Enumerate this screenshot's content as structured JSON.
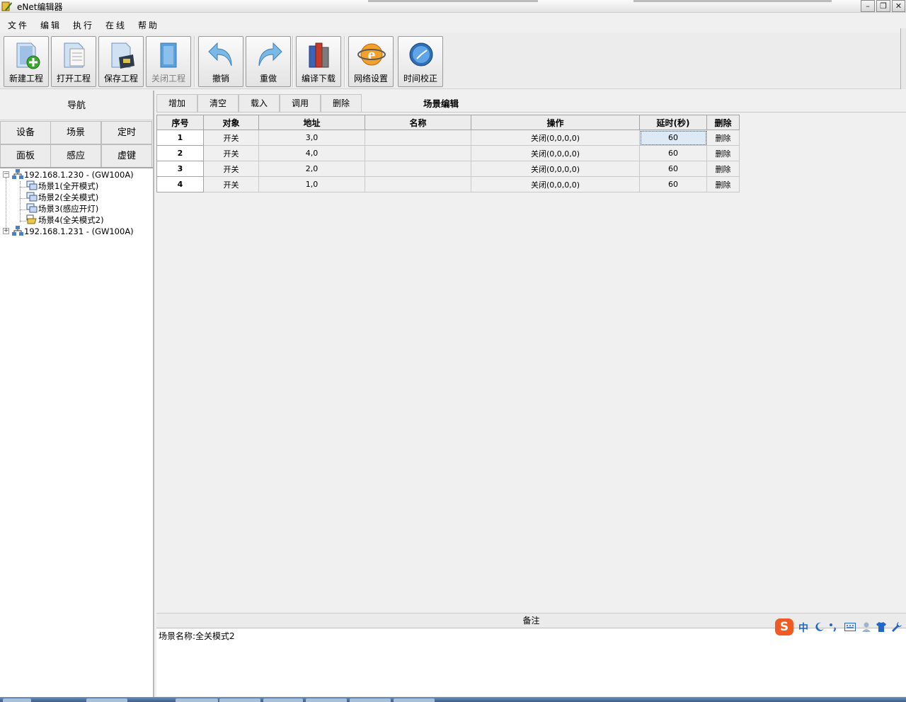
{
  "window": {
    "title": "eNet编辑器"
  },
  "menu": [
    "文件",
    "编辑",
    "执行",
    "在线",
    "帮助"
  ],
  "toolbar": {
    "new_project": "新建工程",
    "open_project": "打开工程",
    "save_project": "保存工程",
    "close_project": "关闭工程",
    "undo": "撤销",
    "redo": "重做",
    "compile_download": "编译下载",
    "network_settings": "网络设置",
    "time_calibrate": "时间校正"
  },
  "nav": {
    "title": "导航",
    "buttons": [
      "设备",
      "场景",
      "定时",
      "面板",
      "感应",
      "虚键"
    ],
    "tree": {
      "gateway1": "192.168.1.230 - (GW100A)",
      "scenes": [
        "场景1(全开模式)",
        "场景2(全关模式)",
        "场景3(感应开灯)",
        "场景4(全关模式2)"
      ],
      "gateway2": "192.168.1.231 - (GW100A)"
    }
  },
  "editor": {
    "title": "场景编辑",
    "tabs": [
      "增加",
      "清空",
      "载入",
      "调用",
      "删除"
    ],
    "columns": [
      "序号",
      "对象",
      "地址",
      "名称",
      "操作",
      "延时(秒)",
      "删除"
    ],
    "rows": [
      [
        "1",
        "开关",
        "3,0",
        "",
        "关闭(0,0,0,0)",
        "60",
        "删除"
      ],
      [
        "2",
        "开关",
        "4,0",
        "",
        "关闭(0,0,0,0)",
        "60",
        "删除"
      ],
      [
        "3",
        "开关",
        "2,0",
        "",
        "关闭(0,0,0,0)",
        "60",
        "删除"
      ],
      [
        "4",
        "开关",
        "1,0",
        "",
        "关闭(0,0,0,0)",
        "60",
        "删除"
      ]
    ]
  },
  "notes": {
    "header": "备注",
    "content": "场景名称:全关模式2"
  },
  "ime": {
    "mode": "中"
  }
}
